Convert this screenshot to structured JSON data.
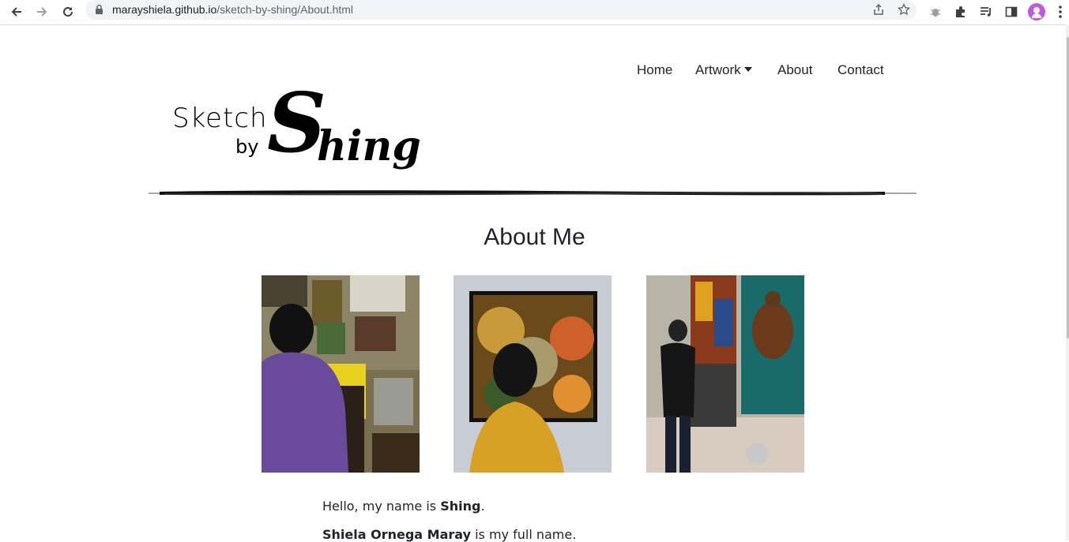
{
  "browser": {
    "url_host": "marayshiela.github.io",
    "url_path": "/sketch-by-shing/About.html"
  },
  "nav": {
    "items": [
      "Home",
      "Artwork",
      "About",
      "Contact"
    ]
  },
  "logo": {
    "line1": "Sketch",
    "line2": "by",
    "big_letter": "S",
    "rest": "hing"
  },
  "page": {
    "heading": "About Me",
    "intro_prefix": "Hello, my name is ",
    "intro_name": "Shing",
    "intro_suffix": ".",
    "fullname": "Shiela Ornega Maray",
    "fullname_suffix": " is my full name."
  },
  "photos": [
    {
      "name": "photo-painting-at-desk"
    },
    {
      "name": "photo-viewing-artwork"
    },
    {
      "name": "photo-gallery-exhibit"
    }
  ],
  "colors": {
    "text": "#212529",
    "chrome_bg": "#f1f3f4"
  }
}
